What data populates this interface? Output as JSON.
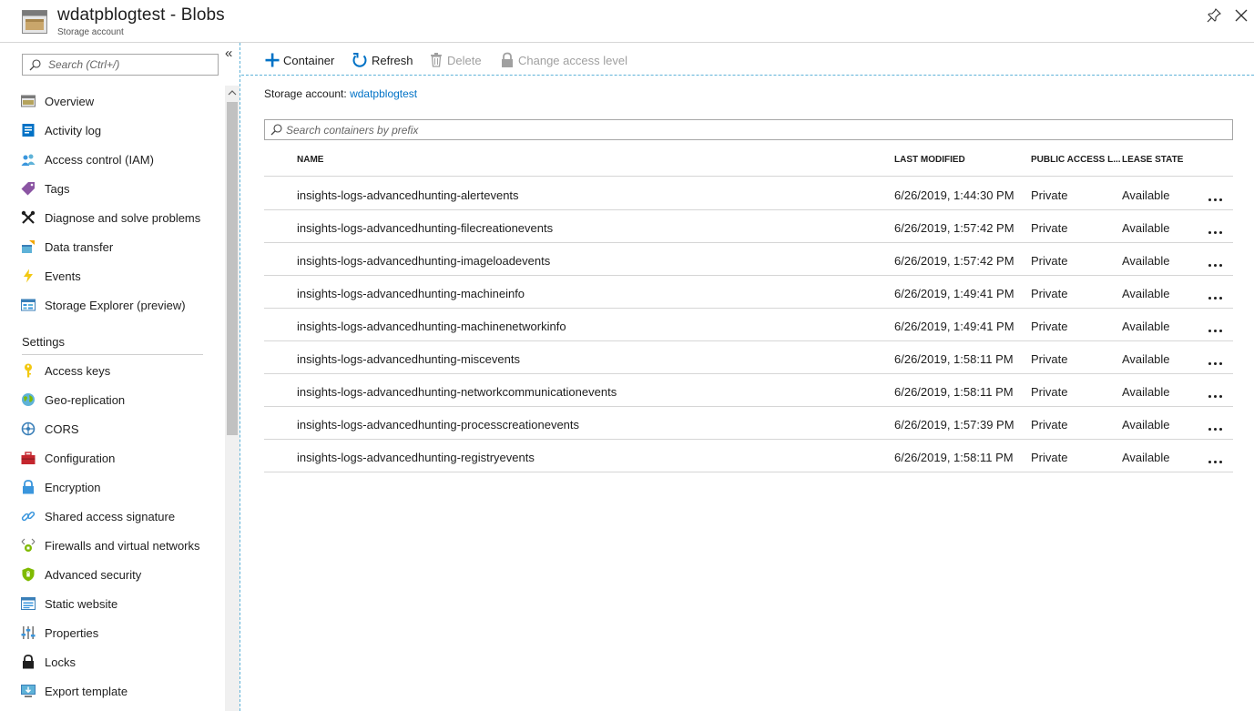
{
  "header": {
    "title": "wdatpblogtest - Blobs",
    "subtitle": "Storage account",
    "icon": "storage-container-icon",
    "pin_icon": "pin-icon",
    "close_icon": "close-icon"
  },
  "sidebar": {
    "search_placeholder": "Search (Ctrl+/)",
    "collapse_label": "«",
    "items": [
      {
        "label": "Overview",
        "icon": "overview-icon"
      },
      {
        "label": "Activity log",
        "icon": "activity-log-icon"
      },
      {
        "label": "Access control (IAM)",
        "icon": "iam-icon"
      },
      {
        "label": "Tags",
        "icon": "tag-icon"
      },
      {
        "label": "Diagnose and solve problems",
        "icon": "wrench-icon"
      },
      {
        "label": "Data transfer",
        "icon": "data-transfer-icon"
      },
      {
        "label": "Events",
        "icon": "lightning-icon"
      },
      {
        "label": "Storage Explorer (preview)",
        "icon": "storage-explorer-icon"
      }
    ],
    "settings_label": "Settings",
    "settings_items": [
      {
        "label": "Access keys",
        "icon": "key-icon"
      },
      {
        "label": "Geo-replication",
        "icon": "globe-icon"
      },
      {
        "label": "CORS",
        "icon": "cors-icon"
      },
      {
        "label": "Configuration",
        "icon": "toolbox-icon"
      },
      {
        "label": "Encryption",
        "icon": "lock-icon"
      },
      {
        "label": "Shared access signature",
        "icon": "link-icon"
      },
      {
        "label": "Firewalls and virtual networks",
        "icon": "firewall-icon"
      },
      {
        "label": "Advanced security",
        "icon": "shield-icon"
      },
      {
        "label": "Static website",
        "icon": "static-website-icon"
      },
      {
        "label": "Properties",
        "icon": "properties-icon"
      },
      {
        "label": "Locks",
        "icon": "padlock-icon"
      },
      {
        "label": "Export template",
        "icon": "export-template-icon"
      }
    ]
  },
  "toolbar": {
    "container_label": "Container",
    "refresh_label": "Refresh",
    "delete_label": "Delete",
    "access_level_label": "Change access level"
  },
  "main": {
    "account_prefix": "Storage account:",
    "account_name": "wdatpblogtest",
    "filter_placeholder": "Search containers by prefix",
    "columns": {
      "name": "NAME",
      "modified": "LAST MODIFIED",
      "public": "PUBLIC ACCESS L...",
      "lease": "LEASE STATE"
    },
    "rows": [
      {
        "name": "insights-logs-advancedhunting-alertevents",
        "modified": "6/26/2019, 1:44:30 PM",
        "public": "Private",
        "lease": "Available"
      },
      {
        "name": "insights-logs-advancedhunting-filecreationevents",
        "modified": "6/26/2019, 1:57:42 PM",
        "public": "Private",
        "lease": "Available"
      },
      {
        "name": "insights-logs-advancedhunting-imageloadevents",
        "modified": "6/26/2019, 1:57:42 PM",
        "public": "Private",
        "lease": "Available"
      },
      {
        "name": "insights-logs-advancedhunting-machineinfo",
        "modified": "6/26/2019, 1:49:41 PM",
        "public": "Private",
        "lease": "Available"
      },
      {
        "name": "insights-logs-advancedhunting-machinenetworkinfo",
        "modified": "6/26/2019, 1:49:41 PM",
        "public": "Private",
        "lease": "Available"
      },
      {
        "name": "insights-logs-advancedhunting-miscevents",
        "modified": "6/26/2019, 1:58:11 PM",
        "public": "Private",
        "lease": "Available"
      },
      {
        "name": "insights-logs-advancedhunting-networkcommunicationevents",
        "modified": "6/26/2019, 1:58:11 PM",
        "public": "Private",
        "lease": "Available"
      },
      {
        "name": "insights-logs-advancedhunting-processcreationevents",
        "modified": "6/26/2019, 1:57:39 PM",
        "public": "Private",
        "lease": "Available"
      },
      {
        "name": "insights-logs-advancedhunting-registryevents",
        "modified": "6/26/2019, 1:58:11 PM",
        "public": "Private",
        "lease": "Available"
      }
    ]
  },
  "colors": {
    "accent": "#0072c6",
    "border_dashed": "#5eb2d8",
    "disabled_text": "#a0a0a0"
  }
}
